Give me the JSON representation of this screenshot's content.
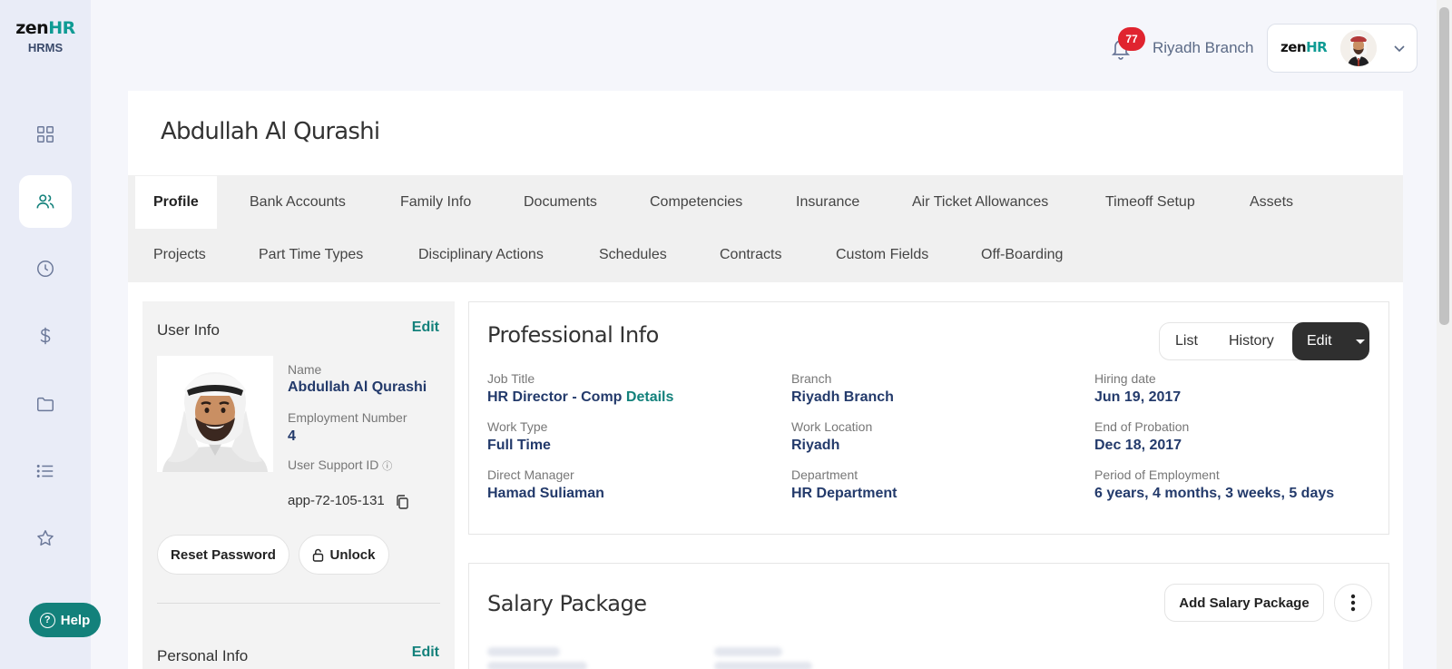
{
  "logo": {
    "brand_a": "zen",
    "brand_b": "HR",
    "sub": "HRMS"
  },
  "sidebar": {
    "items": [
      {
        "icon": "dashboard-icon"
      },
      {
        "icon": "people-icon",
        "active": true
      },
      {
        "icon": "clock-icon"
      },
      {
        "icon": "dollar-icon"
      },
      {
        "icon": "folder-icon"
      },
      {
        "icon": "list-icon"
      },
      {
        "icon": "star-icon"
      }
    ]
  },
  "help": {
    "label": "Help"
  },
  "header": {
    "notification_count": "77",
    "branch": "Riyadh Branch",
    "menu_logo_a": "zen",
    "menu_logo_b": "HR"
  },
  "page": {
    "title": "Abdullah Al Qurashi"
  },
  "tabs": {
    "row1": [
      "Profile",
      "Bank Accounts",
      "Family Info",
      "Documents",
      "Competencies",
      "Insurance",
      "Air Ticket Allowances",
      "Timeoff Setup",
      "Assets"
    ],
    "row2": [
      "Projects",
      "Part Time Types",
      "Disciplinary Actions",
      "Schedules",
      "Contracts",
      "Custom Fields",
      "Off-Boarding"
    ],
    "active": "Profile"
  },
  "user_info": {
    "title": "User Info",
    "edit": "Edit",
    "name_label": "Name",
    "name": "Abdullah Al Qurashi",
    "emp_label": "Employment Number",
    "emp_number": "4",
    "support_label": "User Support ID",
    "support_info_icon": "ⓘ",
    "support_id": "app-72-105-131",
    "reset_password": "Reset Password",
    "unlock": "Unlock",
    "personal_title": "Personal Info",
    "personal_edit": "Edit"
  },
  "professional": {
    "title": "Professional Info",
    "btn_list": "List",
    "btn_history": "History",
    "btn_edit": "Edit",
    "job_title_label": "Job Title",
    "job_title": "HR Director - Comp",
    "job_details": "Details",
    "branch_label": "Branch",
    "branch": "Riyadh Branch",
    "hiring_label": "Hiring date",
    "hiring": "Jun 19, 2017",
    "work_type_label": "Work Type",
    "work_type": "Full Time",
    "work_location_label": "Work Location",
    "work_location": "Riyadh",
    "probation_label": "End of Probation",
    "probation": "Dec 18, 2017",
    "manager_label": "Direct Manager",
    "manager": "Hamad Suliaman",
    "department_label": "Department",
    "department": "HR Department",
    "period_label": "Period of Employment",
    "period": "6 years, 4 months, 3 weeks, 5 days"
  },
  "salary": {
    "title": "Salary Package",
    "add": "Add Salary Package"
  }
}
